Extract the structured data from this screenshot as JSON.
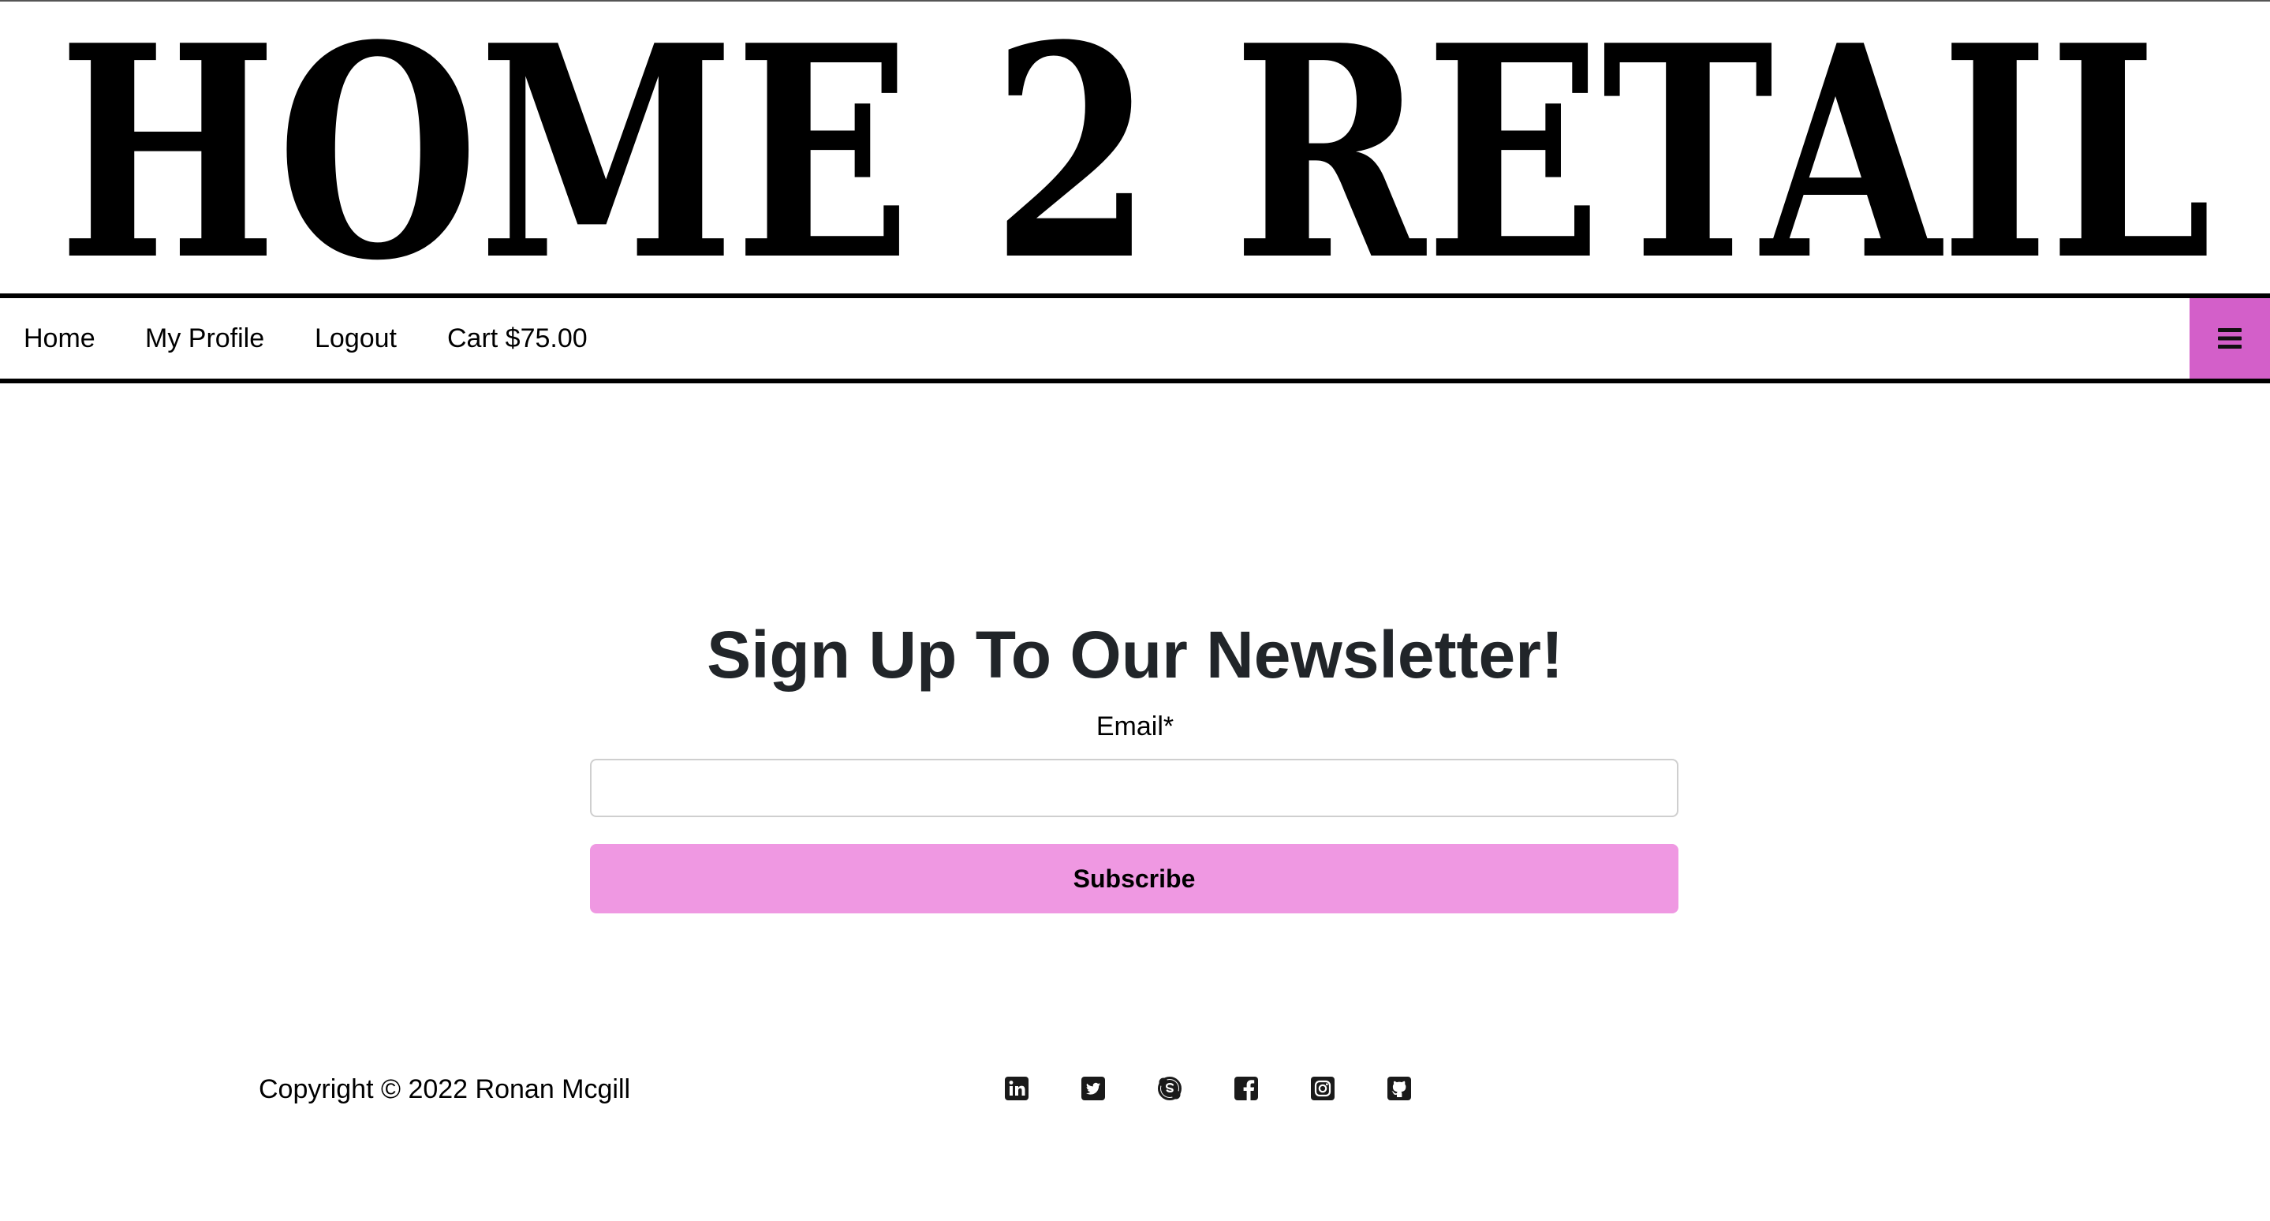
{
  "header": {
    "logo_text": "HOME 2 RETAIL"
  },
  "nav": {
    "links": [
      {
        "label": "Home"
      },
      {
        "label": "My Profile"
      },
      {
        "label": "Logout"
      },
      {
        "label": "Cart $75.00"
      }
    ],
    "menu_icon": "hamburger-icon",
    "menu_color": "#d35fc9"
  },
  "newsletter": {
    "title": "Sign Up To Our Newsletter!",
    "email_label": "Email*",
    "email_value": "",
    "email_placeholder": "",
    "button_label": "Subscribe",
    "button_color": "#ef98e2"
  },
  "footer": {
    "copyright": "Copyright © 2022 Ronan Mcgill",
    "social_icons": [
      "linkedin-icon",
      "twitter-icon",
      "skype-icon",
      "facebook-icon",
      "instagram-icon",
      "github-icon"
    ]
  }
}
